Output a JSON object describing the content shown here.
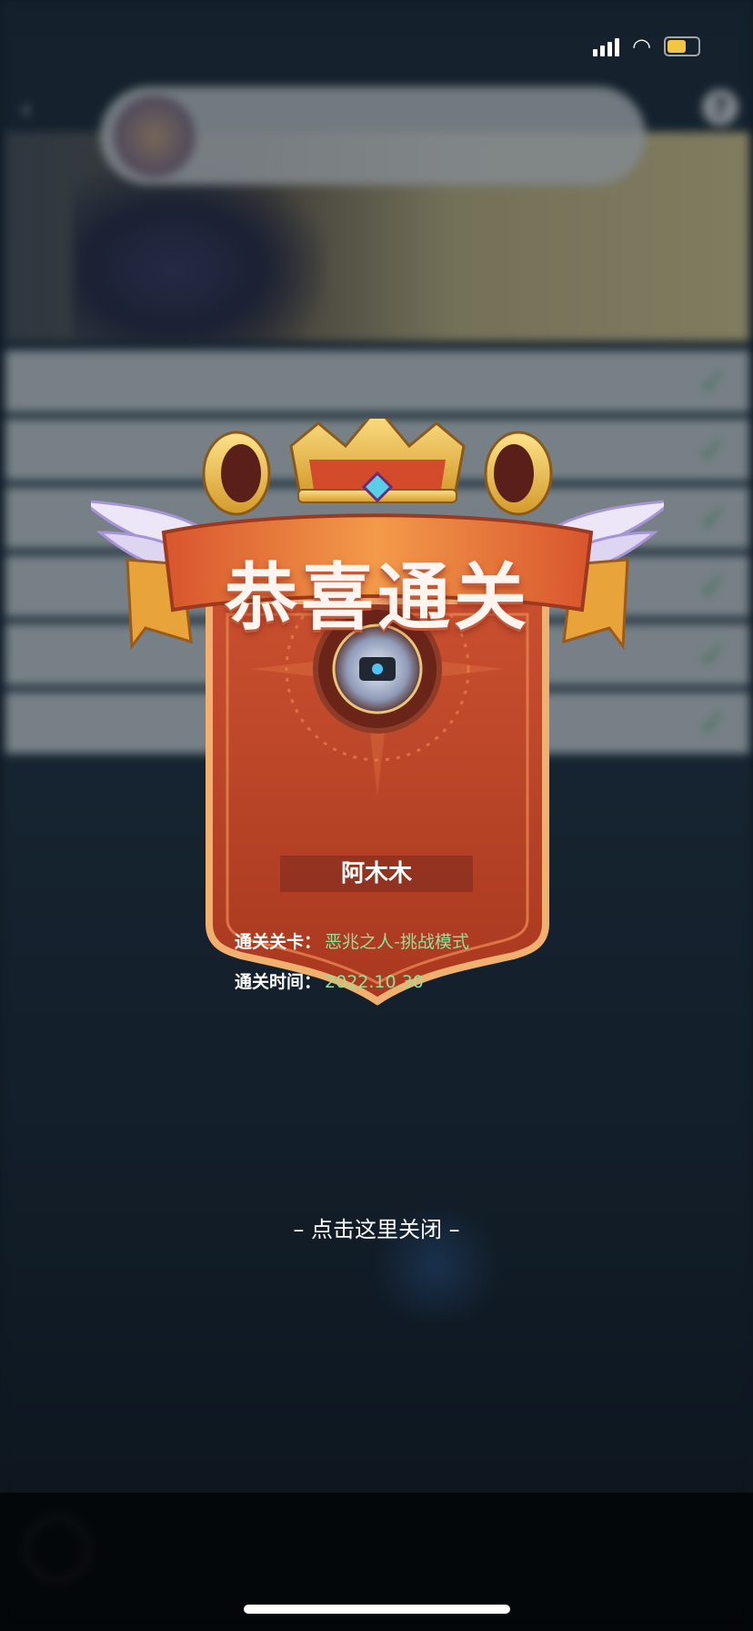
{
  "award": {
    "title": "恭喜通关",
    "player_name": "阿木木",
    "stage_label": "通关关卡：",
    "stage_value": "恶兆之人-挑战模式",
    "time_label": "通关时间：",
    "time_value": "2022.10.30"
  },
  "close_hint": "– 点击这里关闭 –",
  "background": {
    "help_icon_text": "?",
    "level_check_icon": "check-icon",
    "level_count": 6
  },
  "colors": {
    "card_red": "#b5402a",
    "gold": "#e8b64a",
    "info_value_green": "#8ee39a",
    "battery_yellow": "#f5c542"
  }
}
